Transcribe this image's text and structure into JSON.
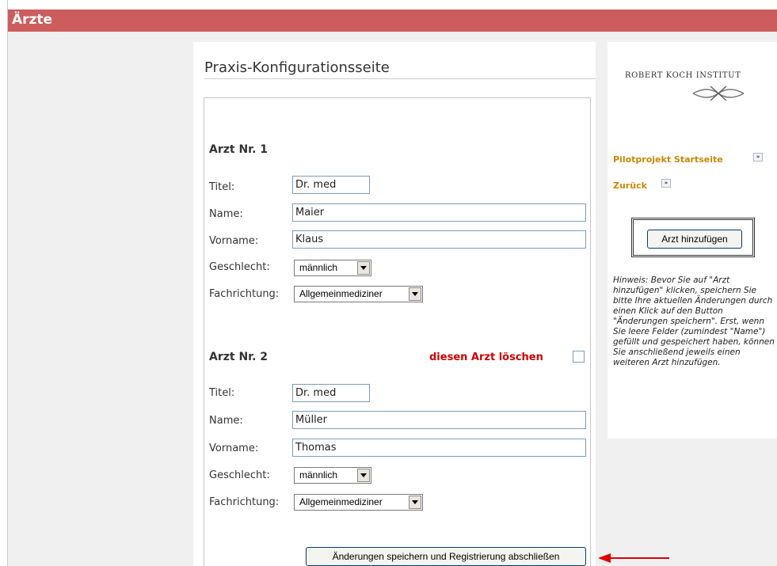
{
  "header": {
    "title": "Ärzte"
  },
  "main": {
    "page_title": "Praxis-Konfigurationsseite",
    "labels": {
      "titel": "Titel:",
      "name": "Name:",
      "vorname": "Vorname:",
      "geschlecht": "Geschlecht:",
      "fachrichtung": "Fachrichtung:"
    },
    "doctors": [
      {
        "heading": "Arzt Nr. 1",
        "titel": "Dr. med",
        "name": "Maier",
        "vorname": "Klaus",
        "geschlecht": "männlich",
        "fachrichtung": "Allgemeinmediziner"
      },
      {
        "heading": "Arzt Nr. 2",
        "titel": "Dr. med",
        "name": "Müller",
        "vorname": "Thomas",
        "geschlecht": "männlich",
        "fachrichtung": "Allgemeinmediziner"
      }
    ],
    "delete_label": "diesen Arzt löschen",
    "save_button": "Änderungen speichern und Registrierung abschließen"
  },
  "sidebar": {
    "logo_text": "ROBERT KOCH INSTITUT",
    "links": {
      "start": "Pilotprojekt Startseite",
      "back": "Zurück",
      "arrow_glyph": "»"
    },
    "add_button": "Arzt hinzufügen",
    "hint": "Hinweis: Bevor Sie auf \"Arzt hinzufügen\" klicken, speichern Sie bitte Ihre aktuellen Änderungen durch einen Klick auf den Button \"Änderungen speichern\". Erst, wenn Sie leere Felder (zumindest \"Name\") gefüllt und gespeichert haben, können Sie anschließend jeweils einen weiteren Arzt hinzufügen."
  },
  "colors": {
    "header": "#cd5c5c",
    "link": "#cc8800",
    "delete": "#d00000",
    "arrow": "#e00000"
  }
}
